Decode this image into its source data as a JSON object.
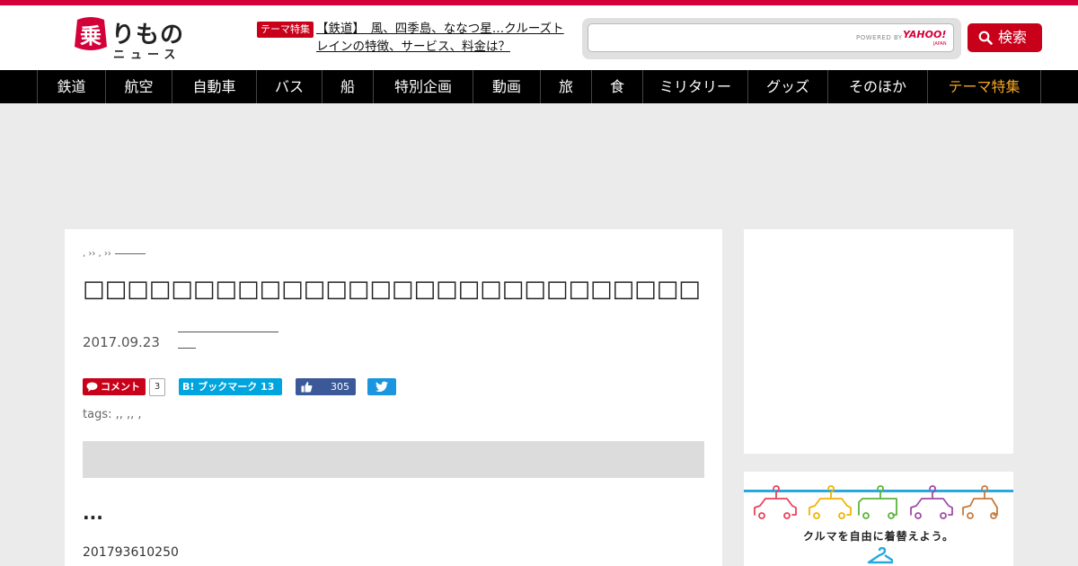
{
  "site": {
    "logo_text": "りもの",
    "logo_mark_char": "乗",
    "logo_sub": "ニュース"
  },
  "header": {
    "feature_badge": "テーマ特集",
    "feature_link": "【鉄道】　風、四季島、ななつ星…クルーズトレインの特徴、サービス、料金は？",
    "search": {
      "placeholder": "",
      "powered_by": "POWERED BY",
      "provider": "YAHOO!",
      "provider_sub": "JAPAN"
    },
    "search_button_label": "検索"
  },
  "nav": {
    "items": [
      {
        "label": "鉄道"
      },
      {
        "label": "航空"
      },
      {
        "label": "自動車"
      },
      {
        "label": "バス"
      },
      {
        "label": "船"
      },
      {
        "label": "特別企画"
      },
      {
        "label": "動画"
      },
      {
        "label": "旅"
      },
      {
        "label": "食"
      },
      {
        "label": "ミリタリー"
      },
      {
        "label": "グッズ"
      },
      {
        "label": "そのほか"
      },
      {
        "label": "テーマ特集"
      }
    ]
  },
  "article": {
    "breadcrumb": ", ›› , ››",
    "title": "□□□□□□□□□□□□□□□□□□□□□□□□□□□□□□□□□□□□□",
    "date": "2017.09.23",
    "comment_label": "コメント",
    "comment_count": "3",
    "hatena_label": "B! ブックマーク 13",
    "like_count": "305",
    "tags": "tags: ,, ,, ,",
    "lead_ellipsis": "...",
    "body_first_line": "201793610250"
  },
  "sidebar": {
    "banner_caption": "クルマを自由に着替えよう。"
  },
  "colors": {
    "brand_red": "#c9001a",
    "nav_bg": "#000000",
    "nav_accent": "#f5a623",
    "hatena_blue": "#00a4de",
    "facebook_blue": "#3b5998",
    "twitter_blue": "#1b95e0"
  },
  "icons": {
    "search": "search-icon",
    "comment": "speech-bubble-icon",
    "like": "thumbs-up-icon",
    "tweet": "twitter-bird-icon"
  }
}
